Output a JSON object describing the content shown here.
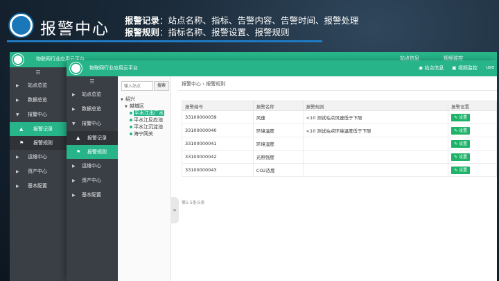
{
  "slide": {
    "title": "报警中心",
    "line1": {
      "key": "报警记录",
      "sep": "：",
      "text": "站点名称、指标、告警内容、告警时间、报警处理"
    },
    "line2": {
      "key": "报警规则",
      "sep": "：",
      "text": "指标名称、报警设置、报警规则"
    }
  },
  "back_window": {
    "app_title": "物联网行业应用云平台",
    "top_right": [
      "站点信息",
      "视频监控"
    ],
    "menu_toggle": "☰",
    "menu": [
      {
        "label": "站点总览",
        "arrow": "▶"
      },
      {
        "label": "数据总览",
        "arrow": "▶"
      },
      {
        "label": "报警中心",
        "arrow": "▼"
      },
      {
        "label": "报警记录",
        "icon": "▲",
        "sub": true,
        "active": true
      },
      {
        "label": "报警规则",
        "icon": "⚑",
        "sub": true
      },
      {
        "label": "运维中心",
        "arrow": "▶"
      },
      {
        "label": "资产中心",
        "arrow": "▶"
      },
      {
        "label": "基本配置",
        "arrow": "▶"
      }
    ]
  },
  "front_window": {
    "app_title": "物联网行业应用云平台",
    "top_right": {
      "site_info": "站点信息",
      "video": "视频监控",
      "user": "use"
    },
    "menu_toggle": "☰",
    "menu": [
      {
        "label": "站点总览",
        "arrow": "▶"
      },
      {
        "label": "数据总览",
        "arrow": "▶"
      },
      {
        "label": "报警中心",
        "arrow": "▼"
      },
      {
        "label": "报警记录",
        "icon": "▲",
        "sub": true
      },
      {
        "label": "报警规则",
        "icon": "⚑",
        "sub": true,
        "active": true
      },
      {
        "label": "运维中心",
        "arrow": "▶"
      },
      {
        "label": "资产中心",
        "arrow": "▶"
      },
      {
        "label": "基本配置",
        "arrow": "▶"
      }
    ],
    "search": {
      "placeholder": "输入站点",
      "button": "搜索"
    },
    "tree": {
      "root": "绍兴",
      "child": "越城区",
      "leaves": [
        "平水江出厂水",
        "平水江反应池",
        "平水江沉淀池",
        "海宁网关"
      ],
      "selected_index": 0
    },
    "collapse_glyph": "«",
    "breadcrumb": "报警中心 › 报警规则",
    "table": {
      "headers": [
        "报警编号",
        "报警名称",
        "报警规则",
        "报警设置"
      ],
      "rows": [
        {
          "id": "33100000039",
          "name": "风速",
          "rule": "<10 测试站点风速低于下限",
          "action": "设置"
        },
        {
          "id": "33100000040",
          "name": "环境温度",
          "rule": "<10 测试站点环境温度低于下限",
          "action": "设置"
        },
        {
          "id": "33100000041",
          "name": "环境湿度",
          "rule": "",
          "action": "设置"
        },
        {
          "id": "33100000042",
          "name": "光照强度",
          "rule": "",
          "action": "设置"
        },
        {
          "id": "33100000043",
          "name": "CO2浓度",
          "rule": "",
          "action": "设置"
        }
      ]
    },
    "pager": "第1-5条/5条"
  },
  "colors": {
    "accent": "#26b488",
    "sidebar": "#3a3f46",
    "button": "#1fb36a",
    "title_bar": "#1e7bc4"
  }
}
